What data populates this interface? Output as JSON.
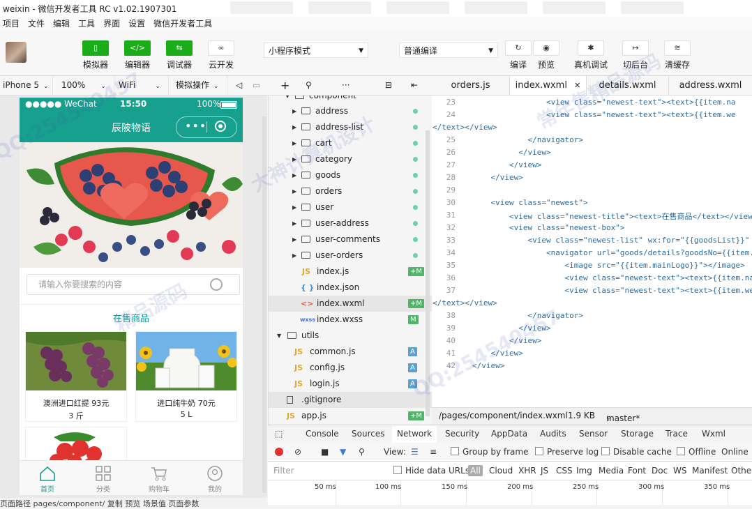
{
  "window": {
    "title": "weixin - 微信开发者工具 RC v1.02.1907301"
  },
  "menu": [
    "项目",
    "文件",
    "编辑",
    "工具",
    "界面",
    "设置",
    "微信开发者工具"
  ],
  "toolbar": {
    "simulator": "模拟器",
    "editor": "编辑器",
    "debugger": "调试器",
    "cloud": "云开发",
    "mode": "小程序模式",
    "compile_mode": "普通编译",
    "compile": "编译",
    "preview": "预览",
    "remote_debug": "真机调试",
    "background": "切后台",
    "clear_cache": "清缓存"
  },
  "subbar": {
    "device": "iPhone 5",
    "zoom": "100%",
    "network": "WiFi",
    "operation": "模拟操作"
  },
  "editor_tabs": [
    "orders.js",
    "index.wxml",
    "details.wxml",
    "address.wxml"
  ],
  "phone": {
    "carrier": "●●●●● WeChat",
    "time": "15:50",
    "battery": "100%",
    "nav_title": "辰陂物语",
    "search_placeholder": "请输入你要搜索的内容",
    "section_title": "在售商品",
    "products": [
      {
        "name": "澳洲进口红提 93元",
        "unit": "3 斤"
      },
      {
        "name": "进口纯牛奶 70元",
        "unit": "5 L"
      }
    ],
    "tabbar": [
      "首页",
      "分类",
      "购物车",
      "我的"
    ],
    "bottom": "页面路径  pages/component/   复制  预览     场景值    页面参数"
  },
  "tree": {
    "root_partial": "component",
    "folders": [
      "address",
      "address-list",
      "cart",
      "category",
      "goods",
      "orders",
      "user",
      "user-address",
      "user-comments",
      "user-orders"
    ],
    "files": [
      {
        "icon": "JS",
        "name": "index.js",
        "badge": "+M"
      },
      {
        "icon": "{ }",
        "name": "index.json",
        "badge": ""
      },
      {
        "icon": "<>",
        "name": "index.wxml",
        "badge": "+M"
      },
      {
        "icon": "wxss",
        "name": "index.wxss",
        "badge": "M"
      }
    ],
    "utils": "utils",
    "util_files": [
      {
        "icon": "JS",
        "name": "common.js",
        "badge": "A"
      },
      {
        "icon": "JS",
        "name": "config.js",
        "badge": "A"
      },
      {
        "icon": "JS",
        "name": "login.js",
        "badge": "A"
      }
    ],
    "gitignore": ".gitignore",
    "appjs": {
      "icon": "JS",
      "name": "app.js",
      "badge": "+M"
    }
  },
  "code": [
    {
      "n": "23",
      "t": "                <view class=\"newest-text\"><text>{{item.na"
    },
    {
      "n": "24",
      "t": "                <view class=\"newest-text\"><text>{{item.we"
    },
    {
      "n": "",
      "t": "</text></view>",
      "wrap": true
    },
    {
      "n": "25",
      "t": "            </navigator>"
    },
    {
      "n": "26",
      "t": "          </view>"
    },
    {
      "n": "27",
      "t": "        </view>"
    },
    {
      "n": "28",
      "t": "    </view>"
    },
    {
      "n": "29",
      "t": ""
    },
    {
      "n": "30",
      "t": "    <view class=\"newest\">"
    },
    {
      "n": "31",
      "t": "        <view class=\"newest-title\"><text>在售商品</text></view"
    },
    {
      "n": "32",
      "t": "        <view class=\"newest-box\">"
    },
    {
      "n": "33",
      "t": "            <view class=\"newest-list\" wx:for=\"{{goodsList}}\""
    },
    {
      "n": "34",
      "t": "                <navigator url=\"goods/details?goodsNo={{item."
    },
    {
      "n": "35",
      "t": "                    <image src=\"{{item.mainLogo}}\"></image>"
    },
    {
      "n": "36",
      "t": "                    <view class=\"newest-text\"><text>{{item.na"
    },
    {
      "n": "37",
      "t": "                    <view class=\"newest-text\"><text>{{item.we"
    },
    {
      "n": "",
      "t": "</text></view>",
      "wrap": true
    },
    {
      "n": "38",
      "t": "            </navigator>"
    },
    {
      "n": "39",
      "t": "          </view>"
    },
    {
      "n": "40",
      "t": "        </view>"
    },
    {
      "n": "41",
      "t": "    </view>"
    },
    {
      "n": "42",
      "t": "</view>"
    }
  ],
  "editor_status": {
    "path": "/pages/component/index.wxml",
    "size": "1.9 KB",
    "branch": "master*"
  },
  "devtools": {
    "tabs": [
      "Console",
      "Sources",
      "Network",
      "Security",
      "AppData",
      "Audits",
      "Sensor",
      "Storage",
      "Trace",
      "Wxml"
    ],
    "view_label": "View:",
    "group_by_frame": "Group by frame",
    "preserve_log": "Preserve log",
    "disable_cache": "Disable cache",
    "offline": "Offline",
    "online": "Online",
    "filter": "Filter",
    "hide_data_urls": "Hide data URLs",
    "types": [
      "All",
      "Cloud",
      "XHR",
      "JS",
      "CSS",
      "Img",
      "Media",
      "Font",
      "Doc",
      "WS",
      "Manifest",
      "Other"
    ],
    "ticks": [
      "50 ms",
      "100 ms",
      "150 ms",
      "200 ms",
      "250 ms",
      "300 ms",
      "350 ms"
    ]
  },
  "watermark": [
    "QQ:254540457",
    "大神计算机设计",
    "精品源码",
    "QQ:254540457",
    "常年售精品源码"
  ]
}
